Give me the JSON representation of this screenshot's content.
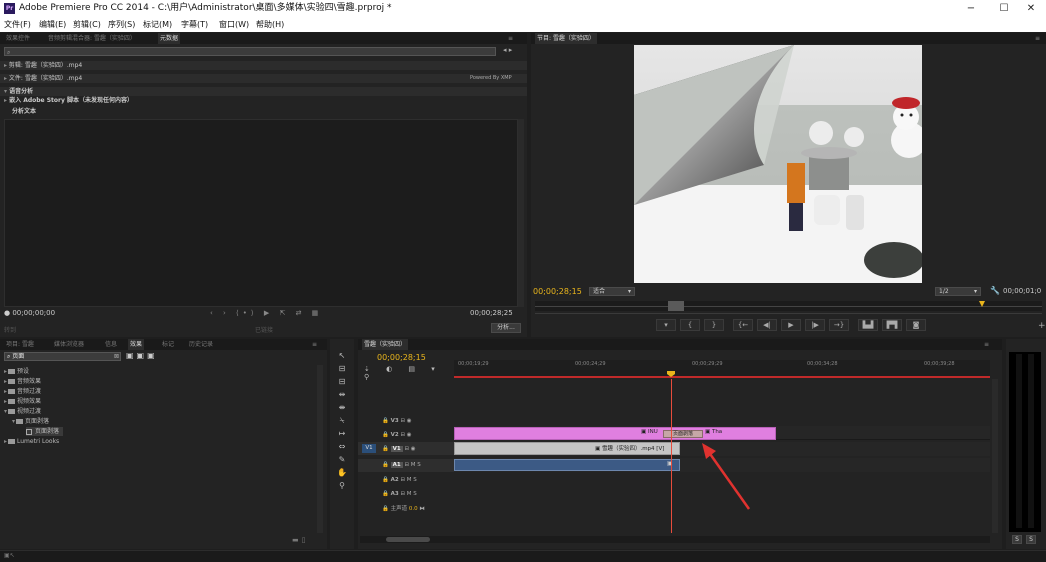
{
  "window": {
    "title": "Adobe Premiere Pro CC 2014 - C:\\用户\\Administrator\\桌面\\多媒体\\实验四\\雪趣.prproj *",
    "logo": "Pr",
    "min": "−",
    "max": "☐",
    "close": "✕"
  },
  "menu": [
    "文件(F)",
    "编辑(E)",
    "剪辑(C)",
    "序列(S)",
    "标记(M)",
    "字幕(T)",
    "窗口(W)",
    "帮助(H)"
  ],
  "source_panel": {
    "tabs": [
      "效果控件",
      "音频剪辑混合器: 雪趣（实验四）",
      "元数据"
    ],
    "rows": [
      "剪辑: 雪趣（实验四）.mp4",
      "文件: 雪趣（实验四）.mp4",
      "语音分析",
      "嵌入 Adobe Story 脚本（未发现任何内容）",
      "分析文本"
    ],
    "xmp_label": "Powered By XMP",
    "timecode_left": "00;00;00;00",
    "timecode_right": "00;00;28;25",
    "analyze_btn": "分析...",
    "status_left": "转到",
    "status_mid": "已链接"
  },
  "program_monitor": {
    "tab": "节目: 雪趣（实验四）",
    "timecode": "00;00;28;15",
    "fit": "适合",
    "quality": "1/2",
    "duration": "00;00;01;0"
  },
  "project_panel": {
    "tabs": [
      "项目: 雪趣",
      "媒体浏览器",
      "信息",
      "效果",
      "标记",
      "历史记录"
    ],
    "search_value": "页面",
    "tree": [
      {
        "label": "预设",
        "indent": 0,
        "type": "folder"
      },
      {
        "label": "音频效果",
        "indent": 0,
        "type": "folder"
      },
      {
        "label": "音频过渡",
        "indent": 0,
        "type": "folder"
      },
      {
        "label": "视频效果",
        "indent": 0,
        "type": "folder"
      },
      {
        "label": "视频过渡",
        "indent": 0,
        "type": "folder"
      },
      {
        "label": "页面剥落",
        "indent": 1,
        "type": "folder"
      },
      {
        "label": "页面剥落",
        "indent": 2,
        "type": "item"
      },
      {
        "label": "Lumetri Looks",
        "indent": 0,
        "type": "folder"
      }
    ]
  },
  "timeline": {
    "tab": "雪趣（实验四）",
    "timecode": "00;00;28;15",
    "ruler": [
      "00;00;19;29",
      "00;00;24;29",
      "00;00;29;29",
      "00;00;34;28",
      "00;00;39;28"
    ],
    "tracks": [
      "V3",
      "V2",
      "V1",
      "A1",
      "A2",
      "A3",
      "主声道"
    ],
    "v1_source": "V1",
    "master_value": "0.0",
    "clips": {
      "v2_a": "INU",
      "v2_b": "Tha",
      "transition": "页面剥落",
      "v1": "雪趣（实验四）.mp4 [V]"
    }
  },
  "meter": {
    "label_left": "S",
    "label_right": "S"
  },
  "colors": {
    "accent": "#e9b51c",
    "v2_clip": "#e07fe0",
    "v1_clip": "#c4c4c4",
    "audio_clip": "#3c5a85",
    "playhead": "#e74c3c"
  }
}
